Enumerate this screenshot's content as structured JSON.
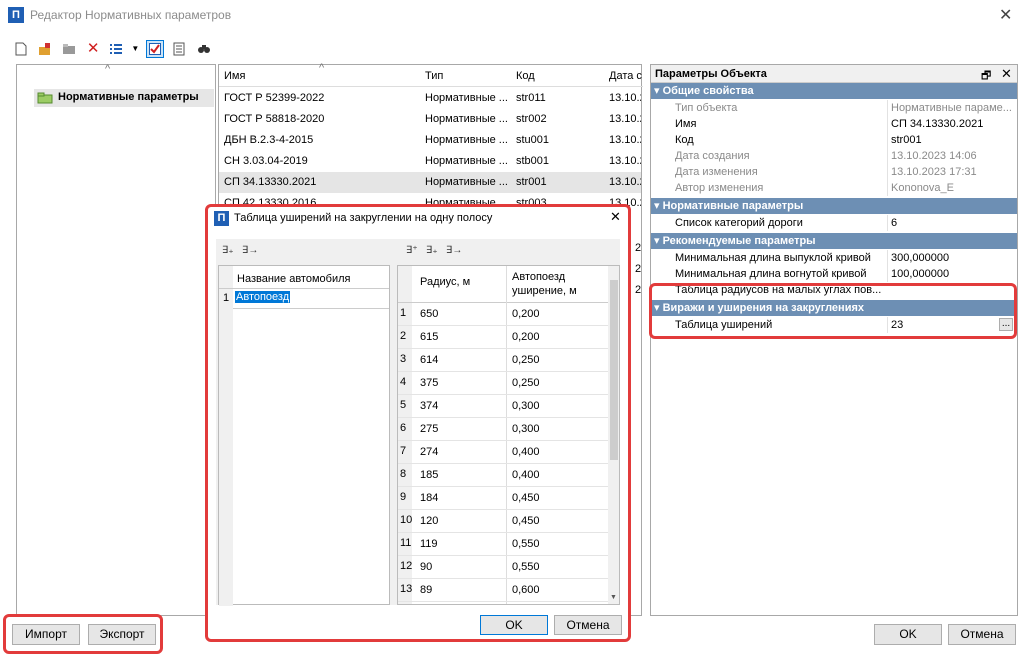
{
  "window": {
    "title": "Редактор Нормативных параметров",
    "icon_letter": "П",
    "close": "✕"
  },
  "toolbar": {
    "icons": [
      "new-icon",
      "open-icon",
      "folder-icon",
      "delete-icon",
      "list-view-icon",
      "dropdown-arrow-icon",
      "checkbox-icon",
      "document-icon",
      "binoculars-icon"
    ]
  },
  "tree": {
    "root_label": "Нормативные параметры",
    "sort_arrow": "^"
  },
  "list": {
    "columns": [
      "Имя",
      "Тип",
      "Код",
      "Дата с"
    ],
    "rows": [
      [
        "ГОСТ Р 52399-2022",
        "Нормативные ...",
        "str011",
        "13.10.2"
      ],
      [
        "ГОСТ Р 58818-2020",
        "Нормативные ...",
        "str002",
        "13.10.2"
      ],
      [
        "ДБН В.2.3-4-2015",
        "Нормативные ...",
        "stu001",
        "13.10.2"
      ],
      [
        "СН 3.03.04-2019",
        "Нормативные ...",
        "stb001",
        "13.10.2"
      ],
      [
        "СП 34.13330.2021",
        "Нормативные ...",
        "str001",
        "13.10.2"
      ],
      [
        "СП 42.13330.2016",
        "Нормативные ...",
        "str003",
        "13.10.2"
      ]
    ],
    "extra_dates": [
      "2",
      "2",
      "2"
    ]
  },
  "props": {
    "title": "Параметры Объекта",
    "sections": [
      {
        "name": "Общие свойства",
        "rows": [
          {
            "k": "Тип объекта",
            "v": "Нормативные параме...",
            "muted": true
          },
          {
            "k": "Имя",
            "v": "СП 34.13330.2021",
            "muted": false
          },
          {
            "k": "Код",
            "v": "str001",
            "muted": false
          },
          {
            "k": "Дата создания",
            "v": "13.10.2023 14:06",
            "muted": true
          },
          {
            "k": "Дата изменения",
            "v": "13.10.2023 17:31",
            "muted": true
          },
          {
            "k": "Автор изменения",
            "v": "Kononova_E",
            "muted": true
          }
        ]
      },
      {
        "name": "Нормативные параметры",
        "rows": [
          {
            "k": "Список категорий дороги",
            "v": "6",
            "muted": false
          }
        ]
      },
      {
        "name": "Рекомендуемые параметры",
        "rows": [
          {
            "k": "Минимальная длина выпуклой кривой",
            "v": "300,000000",
            "muted": false
          },
          {
            "k": "Минимальная длина вогнутой кривой",
            "v": "100,000000",
            "muted": false
          },
          {
            "k": "Таблица радиусов на малых углах пов...",
            "v": "",
            "muted": false
          }
        ]
      },
      {
        "name": "Виражи и уширения на закруглениях",
        "rows": [
          {
            "k": "Таблица уширений",
            "v": "23",
            "muted": false
          }
        ]
      }
    ],
    "ellipsis": "..."
  },
  "dialog": {
    "title": "Таблица уширений на закруглении на одну полосу",
    "left_header": "Название автомобиля",
    "left_rows": [
      {
        "n": "1",
        "name": "Автопоезд"
      }
    ],
    "right_headers": [
      "Радиус, м",
      "Автопоезд",
      "уширение, м"
    ],
    "right_rows": [
      [
        "1",
        "650",
        "0,200"
      ],
      [
        "2",
        "615",
        "0,200"
      ],
      [
        "3",
        "614",
        "0,250"
      ],
      [
        "4",
        "375",
        "0,250"
      ],
      [
        "5",
        "374",
        "0,300"
      ],
      [
        "6",
        "275",
        "0,300"
      ],
      [
        "7",
        "274",
        "0,400"
      ],
      [
        "8",
        "185",
        "0,400"
      ],
      [
        "9",
        "184",
        "0,450"
      ],
      [
        "10",
        "120",
        "0,450"
      ],
      [
        "11",
        "119",
        "0,550"
      ],
      [
        "12",
        "90",
        "0,550"
      ],
      [
        "13",
        "89",
        "0,600"
      ]
    ],
    "ok": "OK",
    "cancel": "Отмена"
  },
  "buttons": {
    "import": "Импорт",
    "export": "Экспорт",
    "ok": "OK",
    "cancel": "Отмена"
  },
  "colors": {
    "accent": "#1f5fb4",
    "highlight": "#e23b3b",
    "section": "#6d8fb4",
    "selection": "#0078d7"
  }
}
